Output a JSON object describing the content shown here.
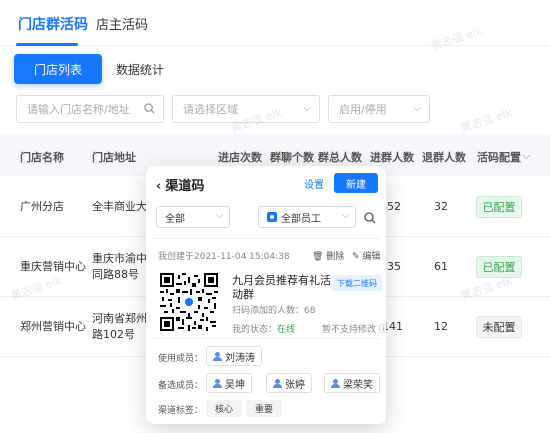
{
  "tabs": {
    "store_group": "门店群活码",
    "owner": "店主活码"
  },
  "toolbar": {
    "store_list": "门店列表",
    "statistics": "数据统计"
  },
  "filters": {
    "search_placeholder": "请输入门店名称/地址",
    "region_placeholder": "请选择区域",
    "status_placeholder": "启用/停用"
  },
  "table": {
    "headers": {
      "name": "门店名称",
      "address": "门店地址",
      "visits": "进店次数",
      "groups": "群聊个数",
      "members": "群总人数",
      "joined": "进群人数",
      "left": "退群人数",
      "config": "活码配置"
    },
    "rows": [
      {
        "name": "广州分店",
        "address": "全丰商业大厦",
        "joined": "652",
        "left": "32",
        "status": "已配置"
      },
      {
        "name": "重庆营销中心",
        "address_line1": "重庆市渝中区",
        "address_line2": "同路88号",
        "joined": "235",
        "left": "61",
        "status": "已配置"
      },
      {
        "name": "郑州营销中心",
        "address_line1": "河南省郑州市",
        "address_line2": "路102号",
        "joined": "2141",
        "left": "12",
        "status": "未配置"
      }
    ]
  },
  "watermark": "黄志强 elk",
  "card": {
    "title": "渠道码",
    "settings": "设置",
    "new_button": "新建",
    "filter_all": "全部",
    "filter_staff": "全部员工",
    "created": "我创建于2021-11-04 15:04:38",
    "delete": "删除",
    "edit": "编辑",
    "campaign": "九月会员推荐有礼活动群",
    "download": "下载二维码",
    "scan_label": "扫码添加的人数：",
    "scan_count": "68",
    "my_status_label": "我的状态：",
    "my_status": "在线",
    "no_edit": "暂不支持修改",
    "members_label": "使用成员：",
    "members": [
      "刘涛涛"
    ],
    "backup_label": "备选成员：",
    "backups": [
      "吴坤",
      "张婷",
      "梁荣笑"
    ],
    "tags_label": "渠道标签：",
    "tags": [
      "核心",
      "重要"
    ]
  }
}
